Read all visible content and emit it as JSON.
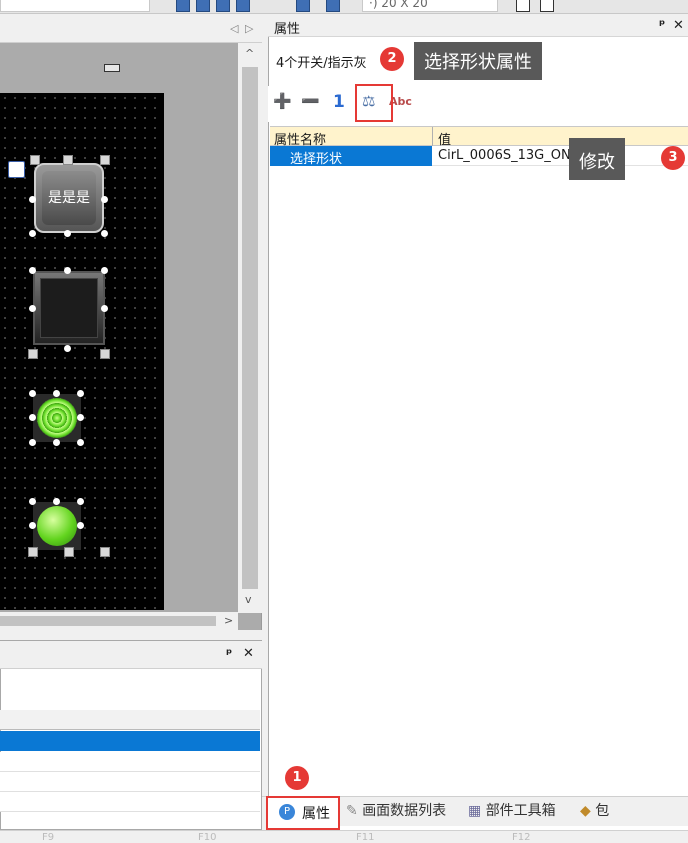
{
  "topbar": {
    "size_text": "·) 20 X 20"
  },
  "canvas": {
    "widget1_label": "是是是"
  },
  "properties": {
    "title": "属性",
    "object_name": "4个开关/指示灰",
    "toolbar": {
      "add_all": "➕",
      "remove_all": "➖",
      "one": "1",
      "select_shape": "⚖",
      "abc": "Abc"
    },
    "grid": {
      "header_name": "属性名称",
      "header_value": "值",
      "rows": [
        {
          "name": "选择形状",
          "value": "CirL_0006S_13G_ON"
        }
      ]
    }
  },
  "tabs": {
    "properties": "属性",
    "screen_data_list": "画面数据列表",
    "parts_toolbox": "部件工具箱",
    "package": "包"
  },
  "callouts": {
    "badge1": "1",
    "badge2": "2",
    "badge3": "3",
    "tip2": "选择形状属性",
    "tip3": "修改"
  },
  "statusbar": {
    "f9": "F9",
    "f10": "F10",
    "f11": "F11",
    "f12": "F12"
  },
  "colors": {
    "accent_red": "#e53935",
    "selection_blue": "#0a78d4",
    "tooltip_gray": "#595959",
    "grid_header": "#fff3cc"
  }
}
